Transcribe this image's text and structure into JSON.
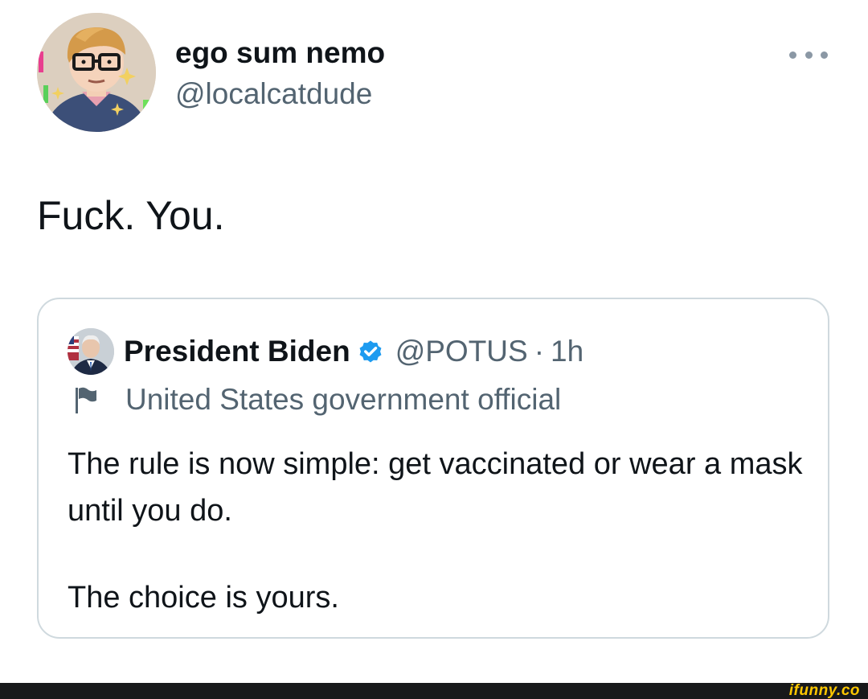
{
  "tweet": {
    "author": {
      "display_name": "ego sum nemo",
      "handle": "@localcatdude",
      "avatar_icon": "cartoon-avatar-icon"
    },
    "more_icon": "more-options-icon",
    "text": "Fuck. You."
  },
  "quoted_tweet": {
    "author": {
      "display_name": "President Biden",
      "handle": "@POTUS",
      "separator": "·",
      "time": "1h",
      "verified": true,
      "avatar_icon": "profile-photo-icon"
    },
    "label": {
      "icon": "flag-icon",
      "text": "United States government official"
    },
    "body": {
      "paragraph_1": "The rule is now simple: get vaccinated or wear a mask until you do.",
      "paragraph_2": "The choice is yours."
    }
  },
  "watermark": {
    "logo_text": "ifunny.co",
    "color": "#ffc700"
  },
  "colors": {
    "text_primary": "#0f1419",
    "text_secondary": "#536471",
    "border": "#cfd9de",
    "verified_blue": "#1d9bf0"
  }
}
